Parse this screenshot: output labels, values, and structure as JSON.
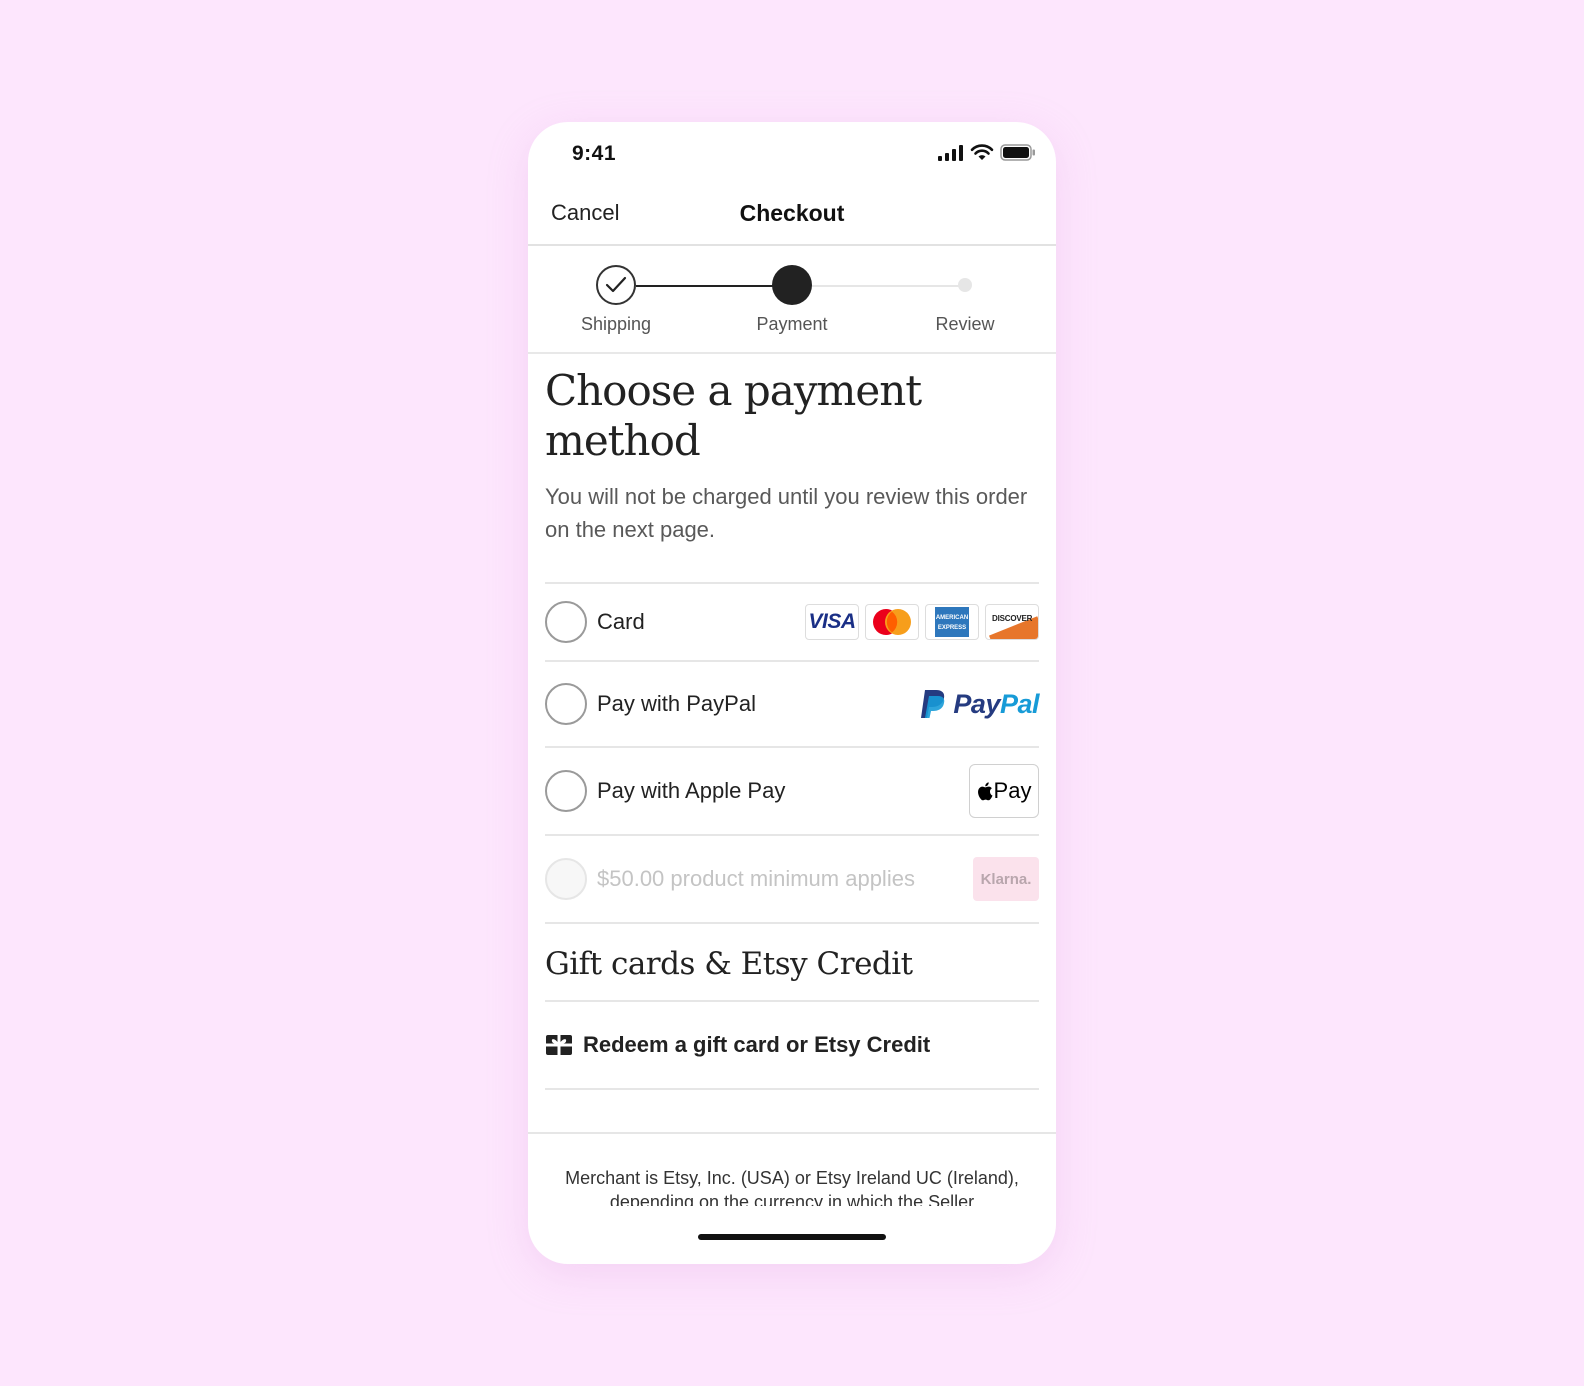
{
  "status_bar": {
    "time": "9:41"
  },
  "nav": {
    "cancel_label": "Cancel",
    "title": "Checkout"
  },
  "steps": [
    {
      "label": "Shipping",
      "state": "complete"
    },
    {
      "label": "Payment",
      "state": "current"
    },
    {
      "label": "Review",
      "state": "upcoming"
    }
  ],
  "page": {
    "heading": "Choose a payment method",
    "subtext": "You will not be charged until you review this order on the next page."
  },
  "methods": {
    "card": {
      "label": "Card",
      "brands": [
        "visa",
        "mastercard",
        "amex",
        "discover"
      ],
      "visa_text": "VISA",
      "amex_text": "AMERICAN EXPRESS",
      "discover_text": "DISCOVER"
    },
    "paypal": {
      "label": "Pay with PayPal",
      "logo_pay": "Pay",
      "logo_pal": "Pal"
    },
    "applepay": {
      "label": "Pay with Apple Pay",
      "logo_text": "Pay"
    },
    "klarna": {
      "label": "$50.00 product minimum applies",
      "logo_text": "Klarna.",
      "disabled": true
    }
  },
  "gift": {
    "title": "Gift cards & Etsy Credit",
    "redeem_label": "Redeem a gift card or Etsy Credit"
  },
  "footer": {
    "text": "Merchant is Etsy, Inc. (USA) or Etsy Ireland UC (Ireland), depending on the currency in which the Seller"
  },
  "colors": {
    "background": "#fde6fd",
    "paypal_dark": "#253b80",
    "paypal_light": "#179bd7",
    "klarna_bg": "#fbe2ec"
  }
}
